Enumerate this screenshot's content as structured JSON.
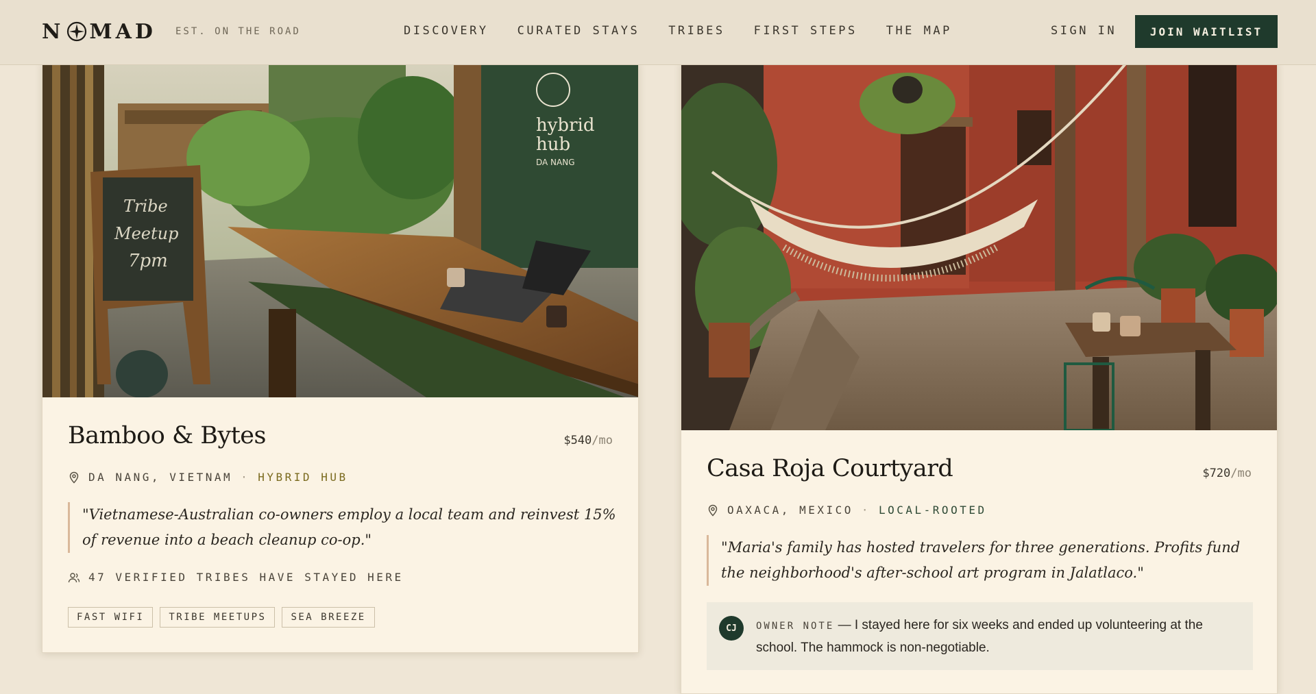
{
  "header": {
    "logo": {
      "left": "N",
      "right": "MAD",
      "icon": "compass-icon"
    },
    "tagline": "EST. ON THE ROAD",
    "nav": [
      "DISCOVERY",
      "CURATED STAYS",
      "TRIBES",
      "FIRST STEPS",
      "THE MAP"
    ],
    "sign_in": "SIGN IN",
    "join_waitlist": "JOIN WAITLIST"
  },
  "listings": [
    {
      "title": "Bamboo & Bytes",
      "price": "$540",
      "price_unit": "/mo",
      "location": "DA NANG, VIETNAM",
      "tag": "HYBRID HUB",
      "quote": "\"Vietnamese-Australian co-owners employ a local team and reinvest 15% of revenue into a beach cleanup co-op.\"",
      "tribes": "47 VERIFIED TRIBES HAVE STAYED HERE",
      "amenities": [
        "FAST WIFI",
        "TRIBE MEETUPS",
        "SEA BREEZE"
      ],
      "photo_signs": {
        "chalkboard": [
          "Tribe",
          "Meetup",
          "7pm"
        ],
        "wall": [
          "hybrid",
          "hub",
          "DA NANG"
        ]
      }
    },
    {
      "title": "Casa Roja Courtyard",
      "price": "$720",
      "price_unit": "/mo",
      "location": "OAXACA, MEXICO",
      "tag": "LOCAL-ROOTED",
      "quote": "\"Maria's family has hosted travelers for three generations. Profits fund the neighborhood's after-school art program in Jalatlaco.\"",
      "owner_note": {
        "initials": "CJ",
        "label": "OWNER NOTE",
        "dash": " — ",
        "text": "I stayed here for six weeks and ended up volunteering at the school. The hammock is non-negotiable."
      }
    }
  ],
  "colors": {
    "accent_dark_green": "#1f3a2c",
    "card_bg": "#fbf3e4",
    "quote_border": "#d9b89a",
    "hybrid_tag": "#7a6a1e"
  }
}
